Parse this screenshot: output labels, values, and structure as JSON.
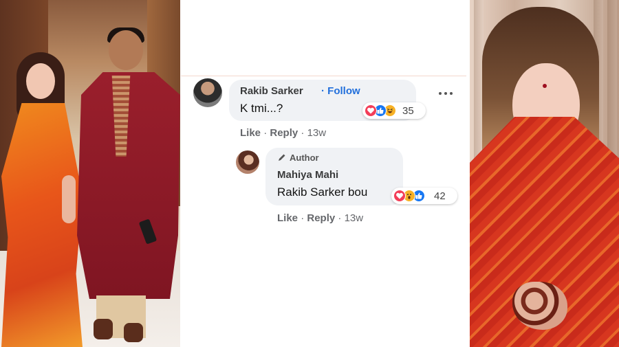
{
  "comments": {
    "first": {
      "author": "Rakib Sarker",
      "follow_label": "· Follow",
      "text": "K tmi...?",
      "reaction_count": "35",
      "reactions": [
        "love-icon",
        "like-icon",
        "haha-icon"
      ],
      "actions": {
        "like": "Like",
        "reply": "Reply",
        "time": "13w"
      }
    },
    "reply": {
      "badge": "Author",
      "author": "Mahiya Mahi",
      "text": "Rakib Sarker bou",
      "reaction_count": "42",
      "reactions": [
        "love-icon",
        "wow-icon",
        "like-icon"
      ],
      "actions": {
        "like": "Like",
        "reply": "Reply",
        "time": "13w"
      }
    }
  },
  "colors": {
    "bubble": "#f0f2f5",
    "follow": "#216fdb",
    "love": "#f33e58",
    "like": "#1877f2",
    "haha": "#f7b125"
  }
}
